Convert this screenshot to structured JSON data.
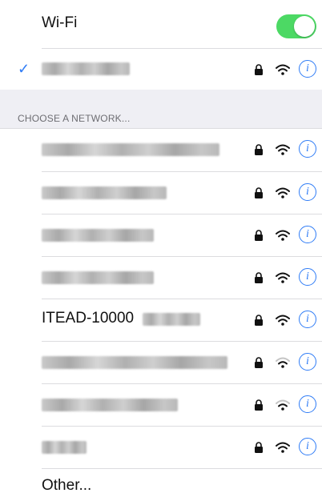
{
  "wifi": {
    "title": "Wi-Fi",
    "enabled": true,
    "accent": "#4cd964"
  },
  "connected": {
    "name": "",
    "secured": true
  },
  "section": {
    "header": "CHOOSE A NETWORK..."
  },
  "networks": [
    {
      "name": "",
      "secured": true,
      "signal": "strong"
    },
    {
      "name": "",
      "secured": true,
      "signal": "strong"
    },
    {
      "name": "",
      "secured": true,
      "signal": "strong"
    },
    {
      "name": "",
      "secured": true,
      "signal": "strong"
    },
    {
      "name": "ITEAD-10000",
      "secured": true,
      "signal": "strong"
    },
    {
      "name": "",
      "secured": true,
      "signal": "weak"
    },
    {
      "name": "",
      "secured": true,
      "signal": "weak"
    },
    {
      "name": "",
      "secured": true,
      "signal": "strong"
    }
  ],
  "other": {
    "label": "Other..."
  },
  "colors": {
    "blue": "#2f7cf6",
    "background": "#efeff4"
  },
  "icons": {
    "check": "checkmark-icon",
    "lock": "lock-icon",
    "wifi": "wifi-icon",
    "info": "info-icon"
  }
}
